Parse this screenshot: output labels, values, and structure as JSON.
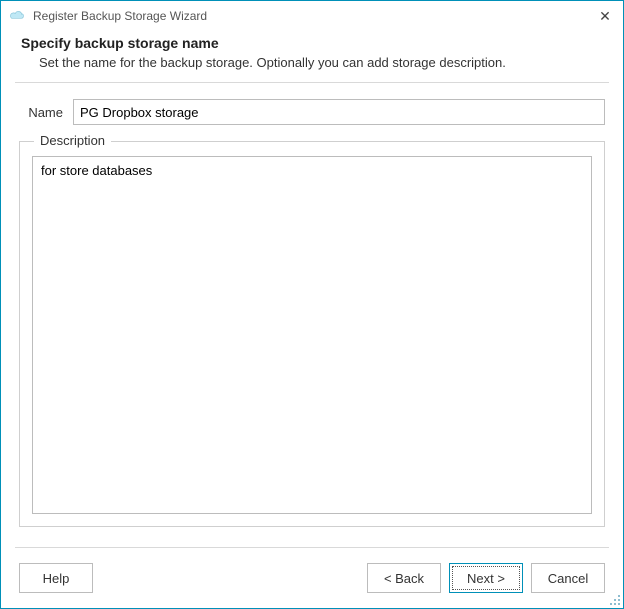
{
  "window": {
    "title": "Register Backup Storage Wizard"
  },
  "header": {
    "heading": "Specify backup storage name",
    "subtitle": "Set the name for the backup storage. Optionally you can add storage description."
  },
  "form": {
    "name_label": "Name",
    "name_value": "PG Dropbox storage",
    "description_label": "Description",
    "description_value": "for store databases"
  },
  "footer": {
    "help_label": "Help",
    "back_label": "< Back",
    "next_label": "Next >",
    "cancel_label": "Cancel"
  }
}
